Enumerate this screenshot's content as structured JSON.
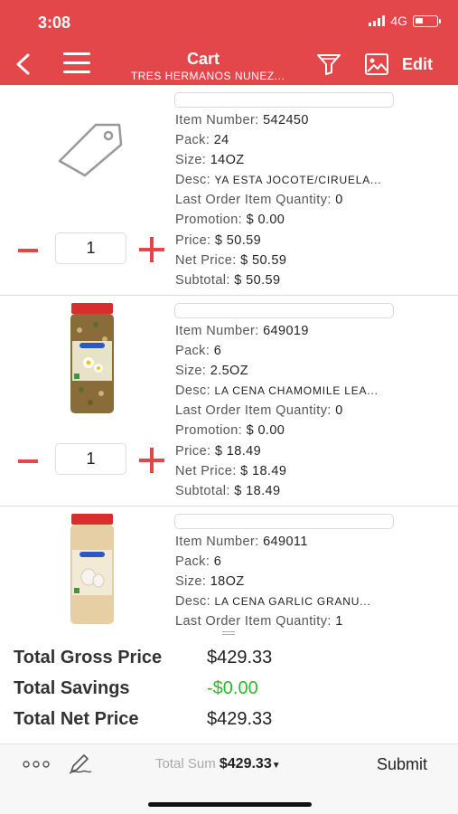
{
  "status": {
    "time": "3:08",
    "network": "4G"
  },
  "nav": {
    "title": "Cart",
    "subtitle": "TRES HERMANOS NUNEZ...",
    "edit_label": "Edit",
    "accent_color": "#e4474a"
  },
  "items": [
    {
      "image": "tag-icon",
      "quantity": "1",
      "rows": [
        {
          "label": "Item Number:",
          "value": "542450"
        },
        {
          "label": "Pack:",
          "value": "24"
        },
        {
          "label": "Size:",
          "value": "14OZ"
        },
        {
          "label": "Desc:",
          "value": "YA ESTA JOCOTE/CIRUELA..."
        },
        {
          "label": "Last Order Item Quantity:",
          "value": "0"
        },
        {
          "label": "Promotion:",
          "value": "$ 0.00"
        },
        {
          "label": "Price:",
          "value": "$ 50.59"
        },
        {
          "label": "Net Price:",
          "value": "$ 50.59"
        },
        {
          "label": "Subtotal:",
          "value": "$ 50.59"
        }
      ]
    },
    {
      "image": "chamomile-jar",
      "quantity": "1",
      "rows": [
        {
          "label": "Item Number:",
          "value": "649019"
        },
        {
          "label": "Pack:",
          "value": "6"
        },
        {
          "label": "Size:",
          "value": "2.5OZ"
        },
        {
          "label": "Desc:",
          "value": "LA CENA CHAMOMILE LEA..."
        },
        {
          "label": "Last Order Item Quantity:",
          "value": "0"
        },
        {
          "label": "Promotion:",
          "value": "$ 0.00"
        },
        {
          "label": "Price:",
          "value": "$ 18.49"
        },
        {
          "label": "Net Price:",
          "value": "$ 18.49"
        },
        {
          "label": "Subtotal:",
          "value": "$ 18.49"
        }
      ]
    },
    {
      "image": "garlic-jar",
      "quantity": "",
      "rows": [
        {
          "label": "Item Number:",
          "value": "649011"
        },
        {
          "label": "Pack:",
          "value": "6"
        },
        {
          "label": "Size:",
          "value": "18OZ"
        },
        {
          "label": "Desc:",
          "value": "LA CENA GARLIC GRANU..."
        },
        {
          "label": "Last Order Item Quantity:",
          "value": "1"
        }
      ]
    }
  ],
  "totals": {
    "gross_label": "Total Gross Price",
    "gross_value": "$429.33",
    "savings_label": "Total Savings",
    "savings_value": "-$0.00",
    "net_label": "Total Net Price",
    "net_value": "$429.33"
  },
  "bottom": {
    "total_sum_label": "Total Sum",
    "total_sum_value": "$429.33",
    "submit_label": "Submit"
  }
}
